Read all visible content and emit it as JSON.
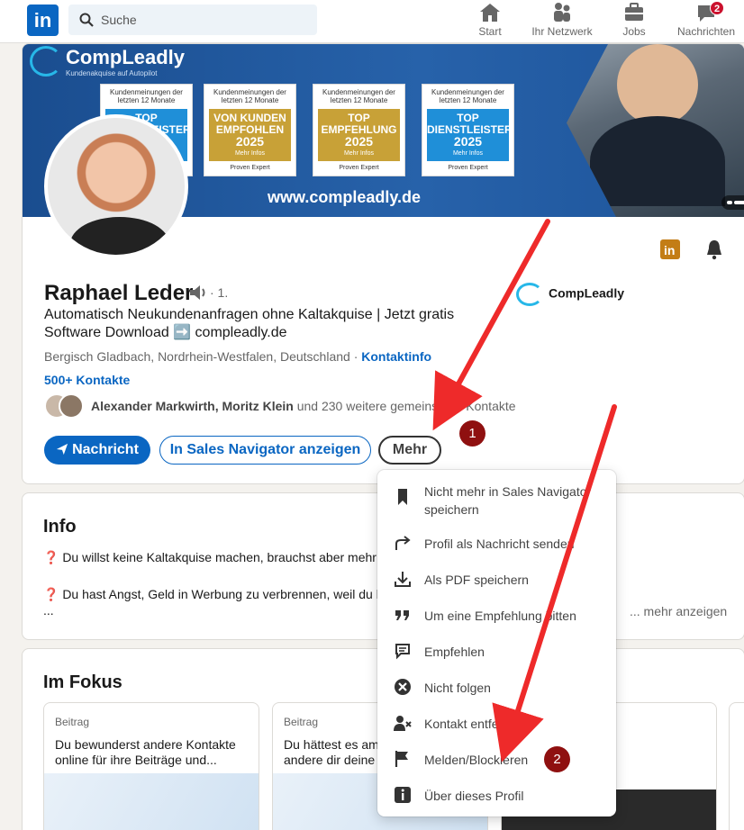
{
  "nav": {
    "logo": "in",
    "search_placeholder": "Suche",
    "items": [
      {
        "label": "Start",
        "icon": "home-icon"
      },
      {
        "label": "Ihr Netzwerk",
        "icon": "network-icon"
      },
      {
        "label": "Jobs",
        "icon": "briefcase-icon"
      },
      {
        "label": "Nachrichten",
        "icon": "messaging-icon",
        "badge": "2"
      }
    ]
  },
  "banner": {
    "brand": "CompLeadly",
    "brand_sub": "Kundenakquise auf Autopilot",
    "awards": [
      {
        "head": "Kundenmeinungen der letzten 12 Monate",
        "title": "TOP DIENSTLEISTER",
        "year": "",
        "more": "",
        "provider": ""
      },
      {
        "head": "Kundenmeinungen der letzten 12 Monate",
        "title": "VON KUNDEN EMPFOHLEN",
        "year": "2025",
        "more": "Mehr Infos",
        "provider": "Proven Expert"
      },
      {
        "head": "Kundenmeinungen der letzten 12 Monate",
        "title": "TOP EMPFEHLUNG",
        "year": "2025",
        "more": "Mehr Infos",
        "provider": "Proven Expert"
      },
      {
        "head": "Kundenmeinungen der letzten 12 Monate",
        "title": "TOP DIENSTLEISTER",
        "year": "2025",
        "more": "Mehr Infos",
        "provider": "Proven Expert"
      }
    ],
    "url": "www.compleadly.de"
  },
  "profile": {
    "name": "Raphael Leder",
    "degree": "· 1.",
    "headline": "Automatisch Neukundenanfragen ohne Kaltakquise | Jetzt gratis Software Download ➡️ compleadly.de",
    "location": "Bergisch Gladbach, Nordrhein-Westfalen, Deutschland",
    "location_sep": " · ",
    "contact_info": "Kontaktinfo",
    "contacts": "500+ Kontakte",
    "mutual_names": "Alexander Markwirth, Moritz Klein",
    "mutual_rest": " und 230 weitere gemeinsame Kontakte",
    "company": "CompLeadly"
  },
  "actions": {
    "message": "Nachricht",
    "sales_nav": "In Sales Navigator anzeigen",
    "more": "Mehr"
  },
  "info": {
    "title": "Info",
    "line1": "❓ Du willst keine Kaltakquise machen, brauchst aber mehr A",
    "line2": "❓ Du hast Angst, Geld in Werbung zu verbrennen, weil du ke",
    "ellipsis": "...",
    "more": "... mehr anzeigen"
  },
  "focus": {
    "title": "Im Fokus",
    "posts": [
      {
        "kind": "Beitrag",
        "text": "Du bewunderst andere Kontakte online für ihre Beiträge und..."
      },
      {
        "kind": "Beitrag",
        "text": "Du hättest es am andere dir deine"
      }
    ]
  },
  "menu": {
    "items": [
      {
        "label": "Nicht mehr in Sales Navigator speichern",
        "icon": "bookmark-icon"
      },
      {
        "label": "Profil als Nachricht senden",
        "icon": "share-icon"
      },
      {
        "label": "Als PDF speichern",
        "icon": "download-icon"
      },
      {
        "label": "Um eine Empfehlung bitten",
        "icon": "quote-icon"
      },
      {
        "label": "Empfehlen",
        "icon": "recommend-icon"
      },
      {
        "label": "Nicht folgen",
        "icon": "unfollow-icon"
      },
      {
        "label": "Kontakt entfernen",
        "icon": "remove-contact-icon"
      },
      {
        "label": "Melden/Blockieren",
        "icon": "flag-icon"
      },
      {
        "label": "Über dieses Profil",
        "icon": "info-icon"
      }
    ]
  },
  "annotations": {
    "step1": "1",
    "step2": "2"
  },
  "colors": {
    "linkedin_blue": "#0a66c2",
    "arrow_red": "#ee2a2a",
    "marker_red": "#8f1010"
  }
}
